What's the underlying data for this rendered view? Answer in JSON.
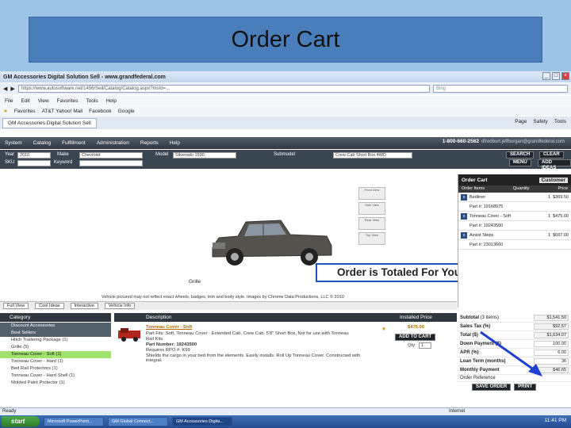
{
  "slide": {
    "title": "Order Cart",
    "callout": "Order is Totaled For You"
  },
  "browser": {
    "window_title": "GM Accessories Digital Solution Sell - www.grandfederal.com",
    "address": "https://www.autosoftware.net/1456/Sell/Catalog/Catalog.aspx?msId=...",
    "search_placeholder": "Bing",
    "menu": [
      "File",
      "Edit",
      "View",
      "Favorites",
      "Tools",
      "Help"
    ],
    "favorites": [
      "Favorites",
      "AT&T Yahoo! Mail",
      "Facebook",
      "Google"
    ],
    "tab": "GM Accessories Digital Solution Sell",
    "tools": [
      "Page",
      "Safety",
      "Tools"
    ],
    "status": "Ready",
    "zone": "Internet"
  },
  "app": {
    "nav": [
      "System",
      "Catalog",
      "Fulfillment",
      "Administration",
      "Reports",
      "Help"
    ],
    "phone": "1-800-660-2562",
    "email": "dfredburt.jeffburgan@grandfederal.com",
    "filters": {
      "year_label": "Year",
      "year_value": "2010",
      "make_label": "Make",
      "make_value": "Chevrolet",
      "model_label": "Model",
      "model_value": "Silverado 1500",
      "submodel_label": "Submodel",
      "submodel_value": "Crew Cab Short Box 4WD",
      "sku_label": "SKU",
      "keyword_label": "Keyword"
    },
    "buttons": {
      "search": "SEARCH",
      "clear": "CLEAR",
      "menu": "MENU",
      "add_ideas": "ADD IDEAS"
    },
    "thumbs": [
      "Front View",
      "Side View",
      "Rear View",
      "Top View"
    ],
    "grille_label": "Grille",
    "disclaimer": "Vehicle pictured may not reflect exact wheels, badges, trim and body style. Images by Chrome Data Productions, LLC © 2010",
    "view_tools": [
      "Full View",
      "Cool Ideas",
      "Interactive",
      "Vehicle Info"
    ]
  },
  "cart": {
    "title": "Order Cart",
    "customer": "Customer",
    "columns": [
      "Order Items",
      "Quantity",
      "Price"
    ],
    "items": [
      {
        "name": "Bedliner",
        "qty": "1",
        "price": "$369.50"
      },
      {
        "name": "Part #: 19168975",
        "qty": "",
        "price": ""
      },
      {
        "name": "Tonneau Cover - Soft",
        "qty": "1",
        "price": "$475.00"
      },
      {
        "name": "Part #: 19243500",
        "qty": "",
        "price": ""
      },
      {
        "name": "Assist Steps",
        "qty": "1",
        "price": "$697.00"
      },
      {
        "name": "Part #: 23013660",
        "qty": "",
        "price": ""
      }
    ]
  },
  "category": {
    "header": "Category",
    "items": [
      {
        "label": "Discount Accessories",
        "kind": "sec"
      },
      {
        "label": "Best Sellers",
        "kind": "sec"
      },
      {
        "label": "Hitch Trailering Package (1)",
        "kind": ""
      },
      {
        "label": "Grille (5)",
        "kind": ""
      },
      {
        "label": "Tonneau Cover - Soft (1)",
        "kind": "sel"
      },
      {
        "label": "Tonneau Cover - Hard (1)",
        "kind": ""
      },
      {
        "label": "Bed Rail Protectors (1)",
        "kind": ""
      },
      {
        "label": "Tonneau Cover - Hard Shell (1)",
        "kind": ""
      },
      {
        "label": "Molded Paint Protector (1)",
        "kind": ""
      }
    ]
  },
  "listing": {
    "desc_header": "Description",
    "price_header": "Installed Price",
    "name": "Tonneau Cover - Soft",
    "fits": "Part Fits: Soft, Tonneau Cover - Extended Cab, Crew Cab, 5'8\" Short Box, Not for use with Tonneau",
    "fits2": "Rail Kits",
    "part_number": "Part Number: 19243500",
    "rpo": "Requires RPO #: K99",
    "note": "Shields the cargo in your bed from the elements. Easily installs. Roll Up Tonneau Cover. Constructed with integral.",
    "price": "$475.00",
    "add_to_cart": "ADD TO CART",
    "qty_label": "Qty:",
    "qty_value": "1"
  },
  "totals": {
    "subtotal_label": "Subtotal",
    "subtotal_items": "(3 items)",
    "subtotal": "$1,541.50",
    "tax_label": "Sales Tax (%)",
    "tax": "$92.57",
    "total_label": "Total ($)",
    "total": "$1,634.07",
    "down_label": "Down Payment ($)",
    "down": "100.00",
    "apr_label": "APR (%)",
    "apr": "6.00",
    "term_label": "Loan Term (months)",
    "term": "36",
    "monthly_label": "Monthly Payment",
    "monthly": "$46.65",
    "order_ref": "Order Reference",
    "save_order": "SAVE ORDER",
    "print": "PRINT"
  },
  "taskbar": {
    "start": "start",
    "tasks": [
      "Microsoft PowerPoint...",
      "GM Global Connect...",
      "GM Accessories Digita..."
    ],
    "clock": "11:41 PM"
  }
}
